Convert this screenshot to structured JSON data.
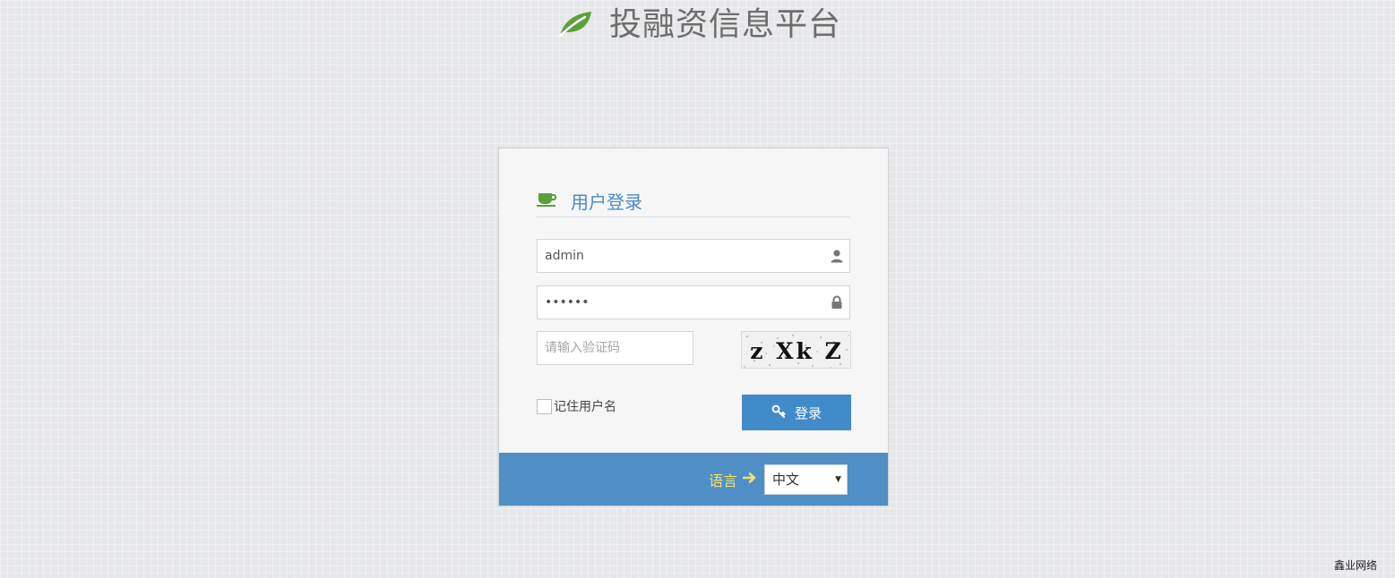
{
  "header": {
    "title": "投融资信息平台",
    "logo_icon": "leaf-icon",
    "logo_color": "#5aa13a"
  },
  "login": {
    "heading": "用户登录",
    "heading_icon": "coffee-cup-icon",
    "username": {
      "value": "admin",
      "icon": "user-icon"
    },
    "password": {
      "value": "••••••",
      "icon": "lock-icon"
    },
    "captcha": {
      "placeholder": "请输入验证码",
      "image_text": "z Xk Z"
    },
    "remember_label": "记住用户名",
    "submit_label": "登录",
    "submit_icon": "key-icon"
  },
  "footer": {
    "language_label": "语言",
    "language_arrow_icon": "arrow-right-icon",
    "language_selected": "中文"
  },
  "watermark": "鑫业网络",
  "colors": {
    "accent": "#428bca",
    "footer_bg": "#4f8fc5",
    "language_label": "#f4e06a",
    "heading_text": "#4a8bc6"
  }
}
